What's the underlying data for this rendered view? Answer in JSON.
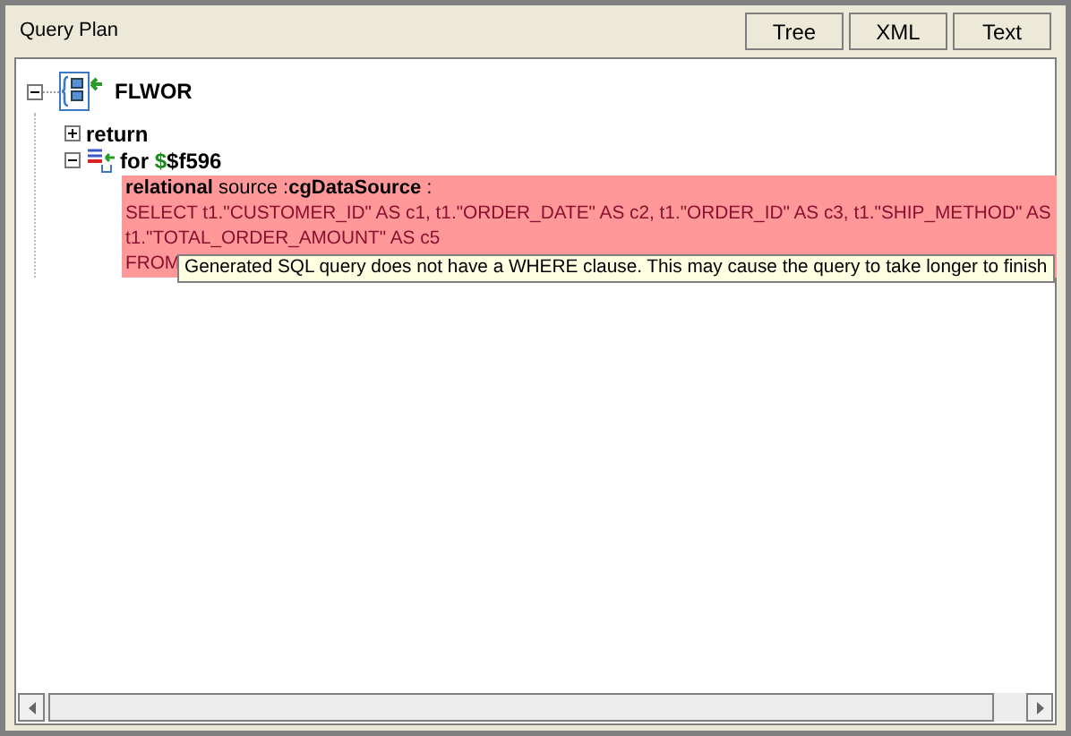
{
  "panel": {
    "title": "Query Plan"
  },
  "view_buttons": [
    {
      "label": "Tree",
      "selected": false
    },
    {
      "label": "XML",
      "selected": false
    },
    {
      "label": "Text",
      "selected": false
    }
  ],
  "tree": {
    "label": "FLWOR",
    "expanded": true,
    "children": [
      {
        "kind": "keyword",
        "label": "return",
        "expanded": false
      },
      {
        "kind": "for",
        "label": "for",
        "sigil": "$",
        "variable": "$f596",
        "expanded": true,
        "children": [
          {
            "kind": "source",
            "heading": "**relational** source :**cgDataSource** :",
            "warning": true,
            "lines": [
              "SELECT t1.\"CUSTOMER_ID\" AS c1, t1.\"ORDER_DATE\" AS c2, t1.\"ORDER_ID\" AS c3, t1.\"SHIP_METHOD\" AS",
              "t1.\"TOTAL_ORDER_AMOUNT\" AS c5",
              "FROM"
            ]
          }
        ]
      }
    ]
  },
  "tooltip": "Generated SQL query does not have a WHERE clause. This may cause the query to take longer to finish"
}
